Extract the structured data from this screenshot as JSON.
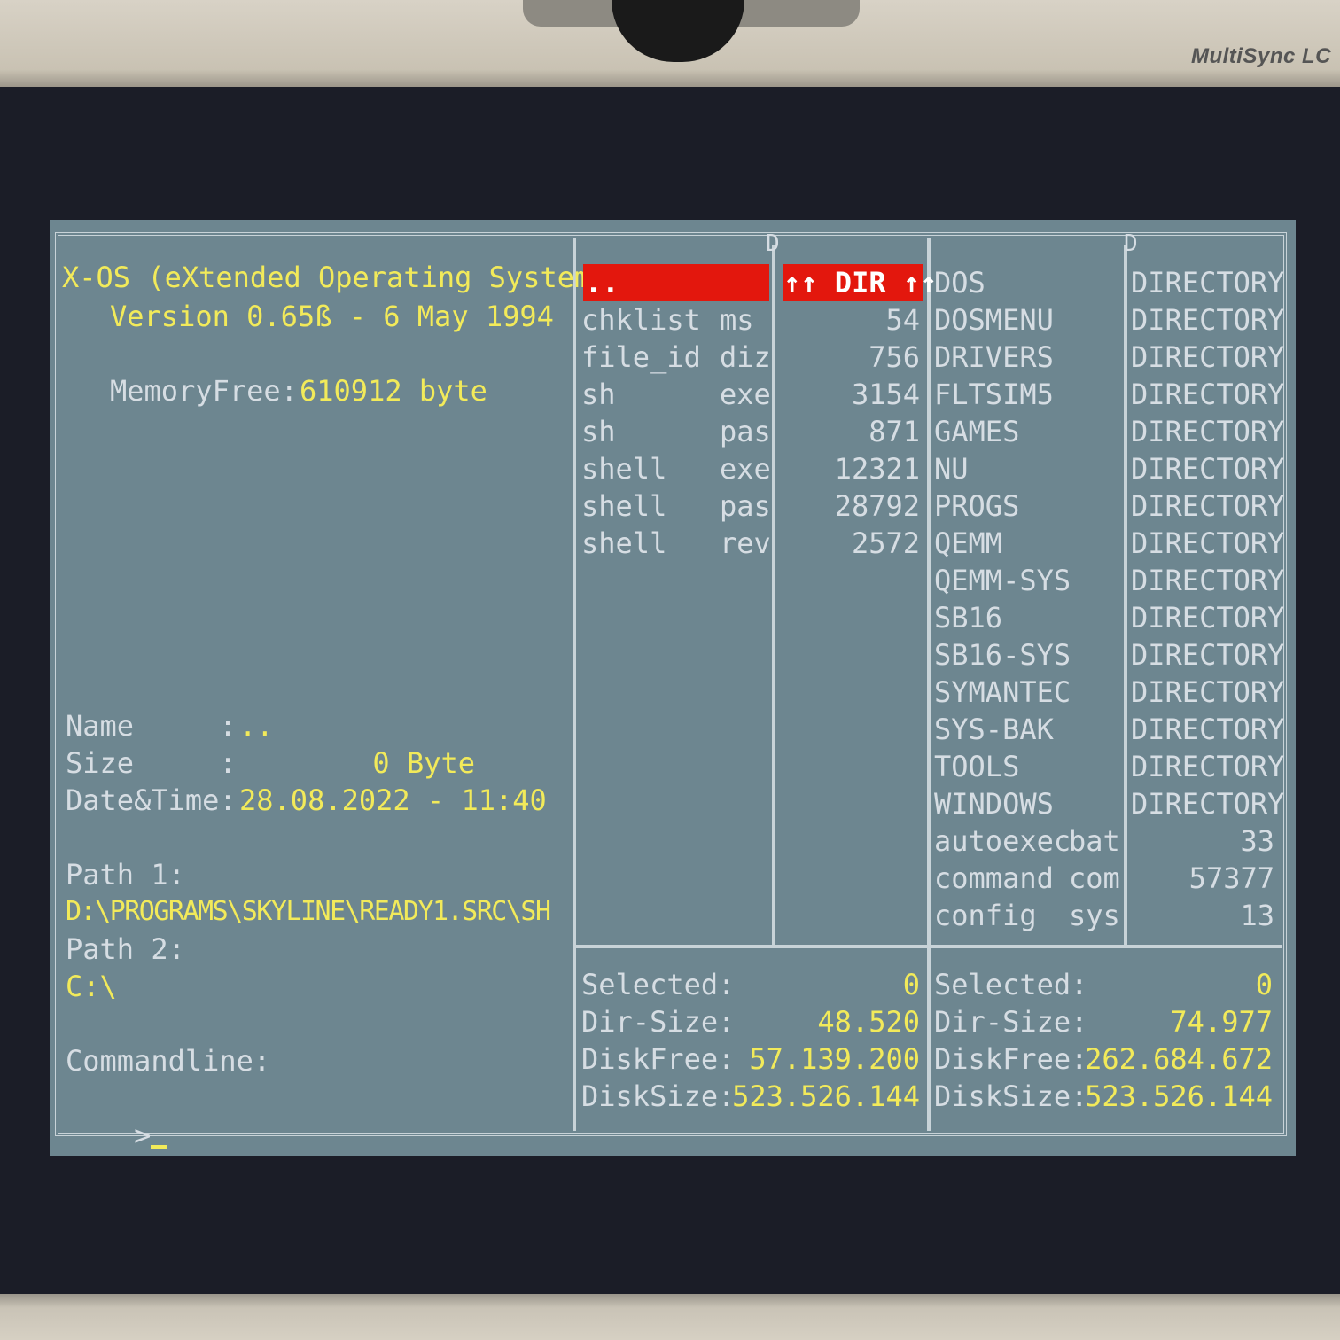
{
  "monitor": {
    "brand": "MultiSync LC"
  },
  "info": {
    "title": "X-OS (eXtended Operating System)",
    "version": "Version 0.65ß - 6 May 1994",
    "memory_label": "MemoryFree:",
    "memory_value": "610912 byte",
    "name_label": "Name     :",
    "name_value": "..",
    "size_label": "Size     :",
    "size_value": "0 Byte",
    "datetime_label": "Date&Time:",
    "datetime_value": "28.08.2022 - 11:40",
    "path1_label": "Path 1:",
    "path1_value": "D:\\PROGRAMS\\SKYLINE\\READY1.SRC\\SH",
    "path2_label": "Path 2:",
    "path2_value": "C:\\",
    "commandline_label": "Commandline:",
    "prompt": ">"
  },
  "panel1": {
    "header_marker": "D",
    "selected_name": "..",
    "selected_info": "↑↑ DIR ↑↑",
    "files": [
      {
        "name": "chklist",
        "ext": "ms",
        "size": "54"
      },
      {
        "name": "file_id",
        "ext": "diz",
        "size": "756"
      },
      {
        "name": "sh",
        "ext": "exe",
        "size": "3154"
      },
      {
        "name": "sh",
        "ext": "pas",
        "size": "871"
      },
      {
        "name": "shell",
        "ext": "exe",
        "size": "12321"
      },
      {
        "name": "shell",
        "ext": "pas",
        "size": "28792"
      },
      {
        "name": "shell",
        "ext": "rev",
        "size": "2572"
      }
    ],
    "stats": {
      "selected_label": "Selected:",
      "selected_value": "0",
      "dirsize_label": "Dir-Size:",
      "dirsize_value": "48.520",
      "diskfree_label": "DiskFree:",
      "diskfree_value": "57.139.200",
      "disksize_label": "DiskSize:",
      "disksize_value": "523.526.144"
    }
  },
  "panel2": {
    "header_marker": "D",
    "files": [
      {
        "name": "DOS",
        "ext": "",
        "size": "DIRECTORY"
      },
      {
        "name": "DOSMENU",
        "ext": "",
        "size": "DIRECTORY"
      },
      {
        "name": "DRIVERS",
        "ext": "",
        "size": "DIRECTORY"
      },
      {
        "name": "FLTSIM5",
        "ext": "",
        "size": "DIRECTORY"
      },
      {
        "name": "GAMES",
        "ext": "",
        "size": "DIRECTORY"
      },
      {
        "name": "NU",
        "ext": "",
        "size": "DIRECTORY"
      },
      {
        "name": "PROGS",
        "ext": "",
        "size": "DIRECTORY"
      },
      {
        "name": "QEMM",
        "ext": "",
        "size": "DIRECTORY"
      },
      {
        "name": "QEMM-SYS",
        "ext": "",
        "size": "DIRECTORY"
      },
      {
        "name": "SB16",
        "ext": "",
        "size": "DIRECTORY"
      },
      {
        "name": "SB16-SYS",
        "ext": "",
        "size": "DIRECTORY"
      },
      {
        "name": "SYMANTEC",
        "ext": "",
        "size": "DIRECTORY"
      },
      {
        "name": "SYS-BAK",
        "ext": "",
        "size": "DIRECTORY"
      },
      {
        "name": "TOOLS",
        "ext": "",
        "size": "DIRECTORY"
      },
      {
        "name": "WINDOWS",
        "ext": "",
        "size": "DIRECTORY"
      },
      {
        "name": "autoexec",
        "ext": "bat",
        "size": "33"
      },
      {
        "name": "command",
        "ext": "com",
        "size": "57377"
      },
      {
        "name": "config",
        "ext": "sys",
        "size": "13"
      }
    ],
    "stats": {
      "selected_label": "Selected:",
      "selected_value": "0",
      "dirsize_label": "Dir-Size:",
      "dirsize_value": "74.977",
      "diskfree_label": "DiskFree:",
      "diskfree_value": "262.684.672",
      "disksize_label": "DiskSize:",
      "disksize_value": "523.526.144"
    }
  }
}
